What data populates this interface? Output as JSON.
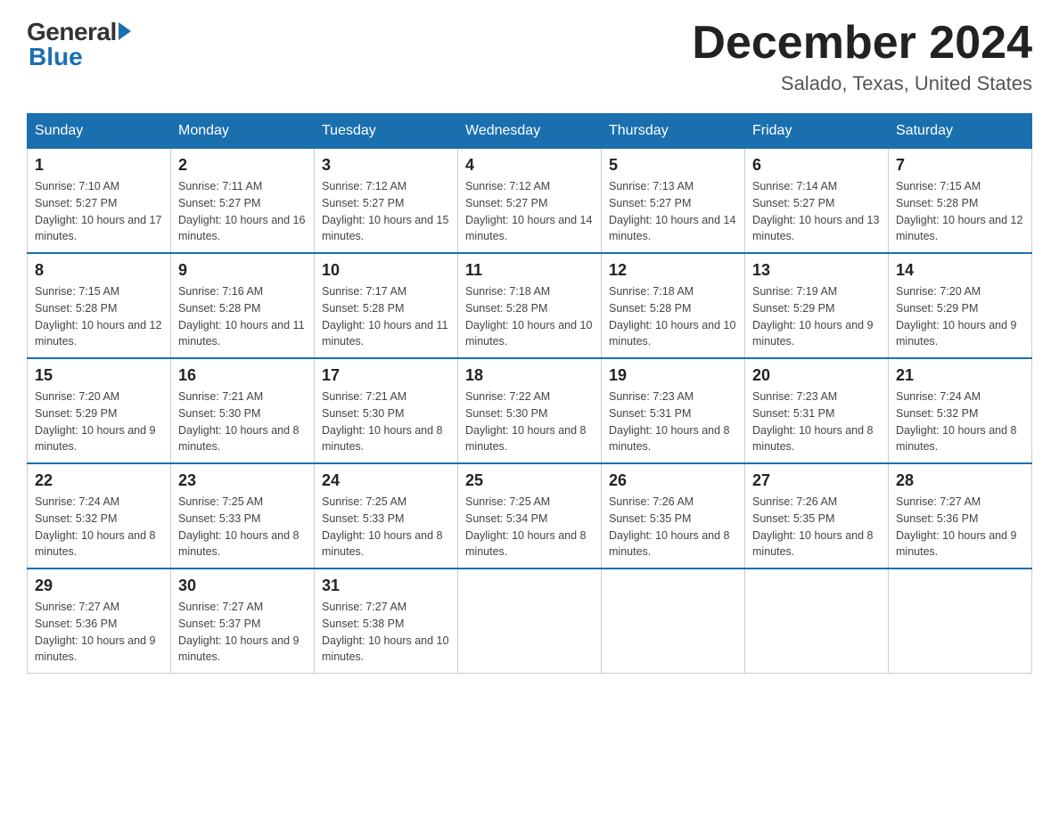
{
  "header": {
    "logo_general": "General",
    "logo_blue": "Blue",
    "title": "December 2024",
    "subtitle": "Salado, Texas, United States"
  },
  "days_of_week": [
    "Sunday",
    "Monday",
    "Tuesday",
    "Wednesday",
    "Thursday",
    "Friday",
    "Saturday"
  ],
  "weeks": [
    [
      {
        "day": "1",
        "sunrise": "Sunrise: 7:10 AM",
        "sunset": "Sunset: 5:27 PM",
        "daylight": "Daylight: 10 hours and 17 minutes."
      },
      {
        "day": "2",
        "sunrise": "Sunrise: 7:11 AM",
        "sunset": "Sunset: 5:27 PM",
        "daylight": "Daylight: 10 hours and 16 minutes."
      },
      {
        "day": "3",
        "sunrise": "Sunrise: 7:12 AM",
        "sunset": "Sunset: 5:27 PM",
        "daylight": "Daylight: 10 hours and 15 minutes."
      },
      {
        "day": "4",
        "sunrise": "Sunrise: 7:12 AM",
        "sunset": "Sunset: 5:27 PM",
        "daylight": "Daylight: 10 hours and 14 minutes."
      },
      {
        "day": "5",
        "sunrise": "Sunrise: 7:13 AM",
        "sunset": "Sunset: 5:27 PM",
        "daylight": "Daylight: 10 hours and 14 minutes."
      },
      {
        "day": "6",
        "sunrise": "Sunrise: 7:14 AM",
        "sunset": "Sunset: 5:27 PM",
        "daylight": "Daylight: 10 hours and 13 minutes."
      },
      {
        "day": "7",
        "sunrise": "Sunrise: 7:15 AM",
        "sunset": "Sunset: 5:28 PM",
        "daylight": "Daylight: 10 hours and 12 minutes."
      }
    ],
    [
      {
        "day": "8",
        "sunrise": "Sunrise: 7:15 AM",
        "sunset": "Sunset: 5:28 PM",
        "daylight": "Daylight: 10 hours and 12 minutes."
      },
      {
        "day": "9",
        "sunrise": "Sunrise: 7:16 AM",
        "sunset": "Sunset: 5:28 PM",
        "daylight": "Daylight: 10 hours and 11 minutes."
      },
      {
        "day": "10",
        "sunrise": "Sunrise: 7:17 AM",
        "sunset": "Sunset: 5:28 PM",
        "daylight": "Daylight: 10 hours and 11 minutes."
      },
      {
        "day": "11",
        "sunrise": "Sunrise: 7:18 AM",
        "sunset": "Sunset: 5:28 PM",
        "daylight": "Daylight: 10 hours and 10 minutes."
      },
      {
        "day": "12",
        "sunrise": "Sunrise: 7:18 AM",
        "sunset": "Sunset: 5:28 PM",
        "daylight": "Daylight: 10 hours and 10 minutes."
      },
      {
        "day": "13",
        "sunrise": "Sunrise: 7:19 AM",
        "sunset": "Sunset: 5:29 PM",
        "daylight": "Daylight: 10 hours and 9 minutes."
      },
      {
        "day": "14",
        "sunrise": "Sunrise: 7:20 AM",
        "sunset": "Sunset: 5:29 PM",
        "daylight": "Daylight: 10 hours and 9 minutes."
      }
    ],
    [
      {
        "day": "15",
        "sunrise": "Sunrise: 7:20 AM",
        "sunset": "Sunset: 5:29 PM",
        "daylight": "Daylight: 10 hours and 9 minutes."
      },
      {
        "day": "16",
        "sunrise": "Sunrise: 7:21 AM",
        "sunset": "Sunset: 5:30 PM",
        "daylight": "Daylight: 10 hours and 8 minutes."
      },
      {
        "day": "17",
        "sunrise": "Sunrise: 7:21 AM",
        "sunset": "Sunset: 5:30 PM",
        "daylight": "Daylight: 10 hours and 8 minutes."
      },
      {
        "day": "18",
        "sunrise": "Sunrise: 7:22 AM",
        "sunset": "Sunset: 5:30 PM",
        "daylight": "Daylight: 10 hours and 8 minutes."
      },
      {
        "day": "19",
        "sunrise": "Sunrise: 7:23 AM",
        "sunset": "Sunset: 5:31 PM",
        "daylight": "Daylight: 10 hours and 8 minutes."
      },
      {
        "day": "20",
        "sunrise": "Sunrise: 7:23 AM",
        "sunset": "Sunset: 5:31 PM",
        "daylight": "Daylight: 10 hours and 8 minutes."
      },
      {
        "day": "21",
        "sunrise": "Sunrise: 7:24 AM",
        "sunset": "Sunset: 5:32 PM",
        "daylight": "Daylight: 10 hours and 8 minutes."
      }
    ],
    [
      {
        "day": "22",
        "sunrise": "Sunrise: 7:24 AM",
        "sunset": "Sunset: 5:32 PM",
        "daylight": "Daylight: 10 hours and 8 minutes."
      },
      {
        "day": "23",
        "sunrise": "Sunrise: 7:25 AM",
        "sunset": "Sunset: 5:33 PM",
        "daylight": "Daylight: 10 hours and 8 minutes."
      },
      {
        "day": "24",
        "sunrise": "Sunrise: 7:25 AM",
        "sunset": "Sunset: 5:33 PM",
        "daylight": "Daylight: 10 hours and 8 minutes."
      },
      {
        "day": "25",
        "sunrise": "Sunrise: 7:25 AM",
        "sunset": "Sunset: 5:34 PM",
        "daylight": "Daylight: 10 hours and 8 minutes."
      },
      {
        "day": "26",
        "sunrise": "Sunrise: 7:26 AM",
        "sunset": "Sunset: 5:35 PM",
        "daylight": "Daylight: 10 hours and 8 minutes."
      },
      {
        "day": "27",
        "sunrise": "Sunrise: 7:26 AM",
        "sunset": "Sunset: 5:35 PM",
        "daylight": "Daylight: 10 hours and 8 minutes."
      },
      {
        "day": "28",
        "sunrise": "Sunrise: 7:27 AM",
        "sunset": "Sunset: 5:36 PM",
        "daylight": "Daylight: 10 hours and 9 minutes."
      }
    ],
    [
      {
        "day": "29",
        "sunrise": "Sunrise: 7:27 AM",
        "sunset": "Sunset: 5:36 PM",
        "daylight": "Daylight: 10 hours and 9 minutes."
      },
      {
        "day": "30",
        "sunrise": "Sunrise: 7:27 AM",
        "sunset": "Sunset: 5:37 PM",
        "daylight": "Daylight: 10 hours and 9 minutes."
      },
      {
        "day": "31",
        "sunrise": "Sunrise: 7:27 AM",
        "sunset": "Sunset: 5:38 PM",
        "daylight": "Daylight: 10 hours and 10 minutes."
      },
      null,
      null,
      null,
      null
    ]
  ]
}
